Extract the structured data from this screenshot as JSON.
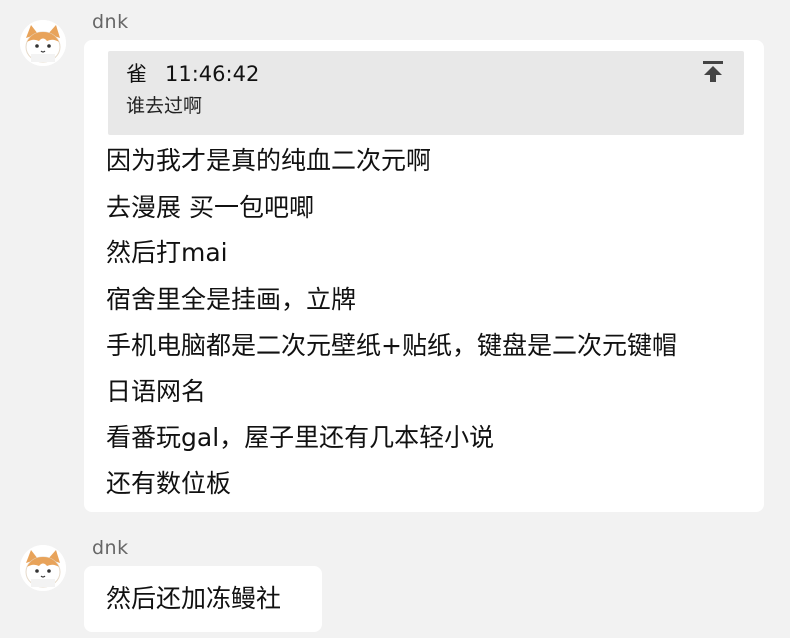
{
  "messages": [
    {
      "sender": "dnk",
      "quote": {
        "author": "雀",
        "time": "11:46:42",
        "text": "谁去过啊"
      },
      "lines": [
        "因为我才是真的纯血二次元啊",
        "去漫展 买一包吧唧",
        "然后打mai",
        "宿舍里全是挂画，立牌",
        "手机电脑都是二次元壁纸+贴纸，键盘是二次元键帽",
        "日语网名",
        "看番玩gal，屋子里还有几本轻小说",
        "还有数位板"
      ]
    },
    {
      "sender": "dnk",
      "lines": [
        "然后还加冻鳗社"
      ]
    }
  ],
  "icons": {
    "avatar": "cat-avatar-icon",
    "pin": "pin-to-top-icon"
  }
}
